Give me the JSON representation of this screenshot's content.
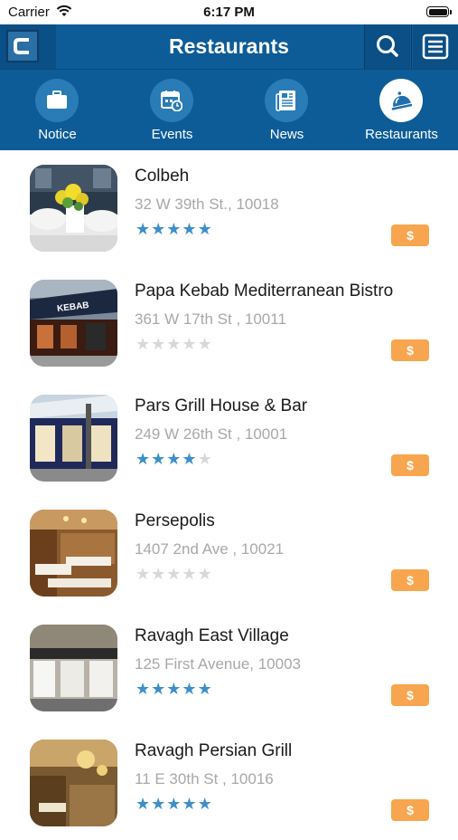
{
  "status": {
    "carrier": "Carrier",
    "time": "6:17 PM"
  },
  "header": {
    "title": "Restaurants"
  },
  "categories": [
    {
      "label": "Notice",
      "icon": "briefcase-icon",
      "active": false
    },
    {
      "label": "Events",
      "icon": "calendar-clock-icon",
      "active": false
    },
    {
      "label": "News",
      "icon": "newspaper-icon",
      "active": false
    },
    {
      "label": "Restaurants",
      "icon": "food-cloche-icon",
      "active": true
    }
  ],
  "restaurants": [
    {
      "name": "Colbeh",
      "address": "32 W 39th St., 10018",
      "rating": 5,
      "price": "$"
    },
    {
      "name": "Papa Kebab Mediterranean Bistro",
      "address": "361 W 17th St , 10011",
      "rating": 0,
      "price": "$"
    },
    {
      "name": "Pars Grill House & Bar",
      "address": "249 W 26th St , 10001",
      "rating": 4,
      "price": "$"
    },
    {
      "name": "Persepolis",
      "address": "1407 2nd Ave , 10021",
      "rating": 0,
      "price": "$"
    },
    {
      "name": "Ravagh East Village",
      "address": "125 First Avenue, 10003",
      "rating": 5,
      "price": "$"
    },
    {
      "name": "Ravagh Persian Grill",
      "address": "11 E 30th St , 10016",
      "rating": 5,
      "price": "$"
    }
  ],
  "colors": {
    "header_bg": "#0d5c98",
    "star_on": "#3e8ec8",
    "star_off": "#d8d8d8",
    "price_badge": "#f7a54e"
  }
}
